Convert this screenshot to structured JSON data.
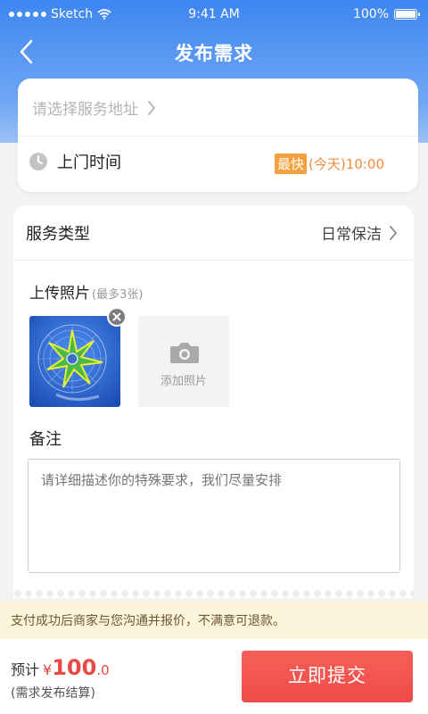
{
  "status_bar": {
    "carrier": "Sketch",
    "time": "9:41 AM",
    "battery": "100%"
  },
  "nav": {
    "title": "发布需求"
  },
  "address": {
    "placeholder": "请选择服务地址"
  },
  "visit_time": {
    "label": "上门时间",
    "badge": "最快",
    "day": "(今天)",
    "time": "10:00"
  },
  "service": {
    "label": "服务类型",
    "value": "日常保洁"
  },
  "upload": {
    "title": "上传照片",
    "hint": "(最多3张)",
    "add_label": "添加照片"
  },
  "note": {
    "title": "备注",
    "placeholder": "请详细描述你的特殊要求，我们尽量安排"
  },
  "notice": {
    "text": "支付成功后商家与您沟通并报价，不满意可退款。"
  },
  "footer": {
    "estimate_label": "预计",
    "currency": "¥",
    "price_int": "100",
    "price_dec": ".0",
    "sub_label": "(需求发布结算)",
    "submit_label": "立即提交"
  },
  "colors": {
    "primary_blue": "#3d86f0",
    "accent_red": "#ee4b46",
    "badge_orange": "#f5a03c"
  }
}
